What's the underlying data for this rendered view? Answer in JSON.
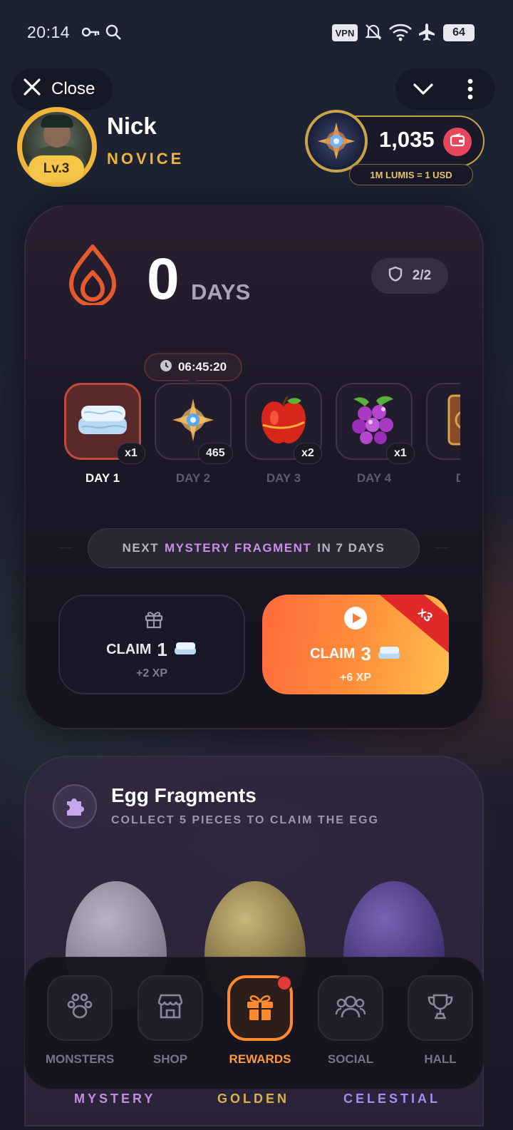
{
  "status_bar": {
    "time": "20:14",
    "vpn": "VPN",
    "battery": "64",
    "icons": [
      "key-icon",
      "search-icon",
      "vpn-icon",
      "bell-off-icon",
      "wifi-icon",
      "airplane-icon",
      "battery-icon"
    ]
  },
  "topbar": {
    "close_label": "Close",
    "icons": [
      "close-icon",
      "chevron-down-icon",
      "more-vertical-icon"
    ]
  },
  "profile": {
    "name": "Nick",
    "rank": "NOVICE",
    "level": "Lv.3"
  },
  "balance": {
    "value": "1,035",
    "rate": "1M LUMIS = 1 USD"
  },
  "streak": {
    "days": "0",
    "days_label": "DAYS",
    "shields": "2/2",
    "timer": "06:45:20",
    "day_tiles": [
      {
        "label": "DAY 1",
        "count": "x1",
        "item": "towel",
        "active": true
      },
      {
        "label": "DAY 2",
        "count": "465",
        "item": "lumis-gem",
        "active": false
      },
      {
        "label": "DAY 3",
        "count": "x2",
        "item": "apple",
        "active": false
      },
      {
        "label": "DAY 4",
        "count": "x1",
        "item": "grapes",
        "active": false
      },
      {
        "label": "DA",
        "count": "",
        "item": "card",
        "active": false
      }
    ],
    "next_prefix": "NEXT",
    "next_highlight": "MYSTERY FRAGMENT",
    "next_suffix": "IN 7 DAYS",
    "claim_basic": {
      "label": "CLAIM",
      "amount": "1",
      "xp": "+2 XP"
    },
    "claim_premium": {
      "label": "CLAIM",
      "amount": "3",
      "xp": "+6 XP",
      "ribbon": "x3"
    }
  },
  "egg_fragments": {
    "title": "Egg Fragments",
    "subtitle": "COLLECT 5 PIECES TO CLAIM THE EGG",
    "eggs": [
      "MYSTERY",
      "GOLDEN",
      "CELESTIAL"
    ]
  },
  "nav": {
    "items": [
      {
        "label": "MONSTERS",
        "icon": "paw-icon"
      },
      {
        "label": "SHOP",
        "icon": "store-icon"
      },
      {
        "label": "REWARDS",
        "icon": "gift-icon"
      },
      {
        "label": "SOCIAL",
        "icon": "users-icon"
      },
      {
        "label": "HALL",
        "icon": "trophy-icon"
      }
    ],
    "active": "REWARDS"
  },
  "colors": {
    "accent_orange": "#ff8a2e",
    "gold": "#f0b43a",
    "mystery": "#c98ee6",
    "golden": "#e0b84a",
    "celestial": "#a58cf0"
  }
}
